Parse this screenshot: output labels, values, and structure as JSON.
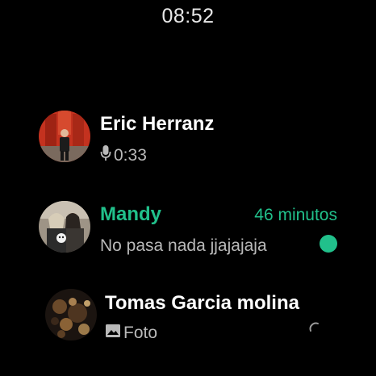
{
  "status": {
    "time": "08:52"
  },
  "chats": [
    {
      "name": "Eric Herranz",
      "preview": "0:33",
      "preview_icon": "microphone-icon",
      "time": "",
      "unread": false
    },
    {
      "name": "Mandy",
      "preview": "No pasa nada jjajajaja",
      "preview_icon": "",
      "time": "46 minutos",
      "unread": true
    },
    {
      "name": "Tomas Garcia molina",
      "preview": "Foto",
      "preview_icon": "photo-icon",
      "time": "",
      "unread": false
    }
  ],
  "colors": {
    "accent": "#21c08b",
    "background": "#000000",
    "name": "#ffffff",
    "preview": "#b9b9b9"
  }
}
